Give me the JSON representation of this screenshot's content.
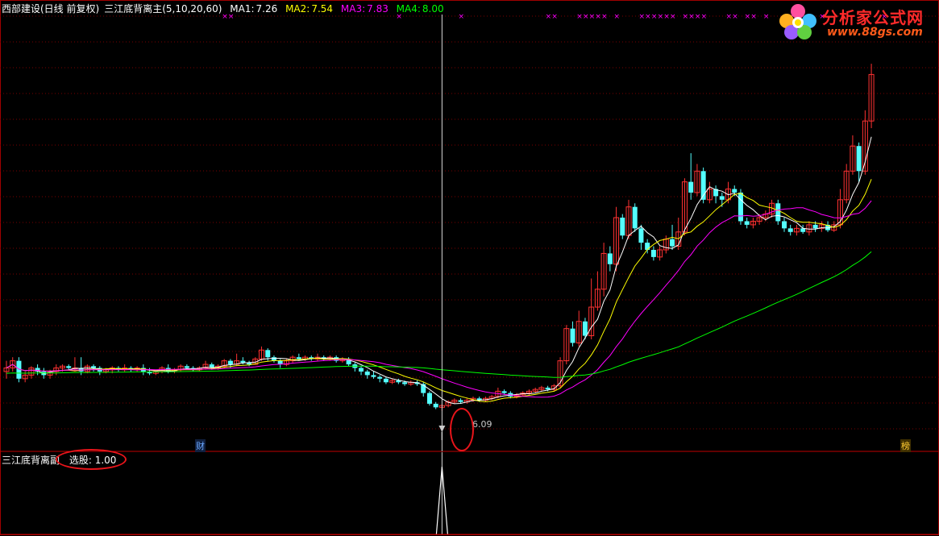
{
  "header": {
    "stock": "西部建设(日线 前复权)",
    "indicator": "三江底背离主",
    "params": "(5,10,20,60)",
    "ma1": {
      "label": "MA1:",
      "value": "7.26",
      "color": "#ffffff"
    },
    "ma2": {
      "label": "MA2:",
      "value": "7.54",
      "color": "#ffff00"
    },
    "ma3": {
      "label": "MA3:",
      "value": "7.83",
      "color": "#ff00ff"
    },
    "ma4": {
      "label": "MA4:",
      "value": "8.00",
      "color": "#00ff00"
    }
  },
  "lower": {
    "title": "三江底背离副",
    "selection_label": "选股:",
    "selection_value": "1.00"
  },
  "logo": {
    "title": "分析家公式网",
    "url": "www.88gs.com"
  },
  "annotations": {
    "low_price": "6.09",
    "fin_marker": "财",
    "rank_marker": "榜"
  },
  "colors": {
    "up": "#ff3232",
    "down": "#54ffff",
    "grid": "#7a0000",
    "ma1": "#ffffff",
    "ma2": "#ffff00",
    "ma3": "#ff00ff",
    "ma4": "#00ff00",
    "cross": "#ff00ff"
  },
  "chart_data": {
    "type": "candlestick",
    "main_cross_marks": [
      35,
      36,
      63,
      73,
      87,
      88,
      92,
      93,
      94,
      95,
      96,
      98,
      102,
      103,
      104,
      105,
      106,
      107,
      109,
      110,
      111,
      112,
      116,
      117,
      119,
      120,
      122,
      126,
      131,
      141
    ],
    "candles": [
      [
        7.2,
        7.3,
        7.5,
        7.0
      ],
      [
        7.3,
        7.5,
        7.6,
        7.2
      ],
      [
        7.5,
        7.0,
        7.6,
        6.9
      ],
      [
        7.0,
        7.1,
        7.2,
        6.9
      ],
      [
        7.1,
        7.3,
        7.35,
        7.0
      ],
      [
        7.3,
        7.2,
        7.4,
        7.1
      ],
      [
        7.2,
        7.1,
        7.3,
        7.0
      ],
      [
        7.1,
        7.2,
        7.25,
        7.0
      ],
      [
        7.2,
        7.3,
        7.4,
        7.1
      ],
      [
        7.3,
        7.35,
        7.4,
        7.2
      ],
      [
        7.35,
        7.3,
        7.4,
        7.25
      ],
      [
        7.3,
        7.3,
        7.6,
        7.2
      ],
      [
        7.3,
        7.2,
        7.6,
        7.1
      ],
      [
        7.2,
        7.35,
        7.4,
        7.15
      ],
      [
        7.35,
        7.3,
        7.4,
        7.2
      ],
      [
        7.3,
        7.2,
        7.35,
        7.1
      ],
      [
        7.2,
        7.25,
        7.3,
        7.15
      ],
      [
        7.25,
        7.3,
        7.35,
        7.15
      ],
      [
        7.3,
        7.25,
        7.35,
        7.2
      ],
      [
        7.25,
        7.3,
        7.4,
        7.2
      ],
      [
        7.3,
        7.25,
        7.35,
        7.2
      ],
      [
        7.25,
        7.3,
        7.35,
        7.2
      ],
      [
        7.3,
        7.2,
        7.4,
        7.1
      ],
      [
        7.2,
        7.15,
        7.3,
        7.1
      ],
      [
        7.15,
        7.2,
        7.25,
        7.1
      ],
      [
        7.2,
        7.3,
        7.35,
        7.15
      ],
      [
        7.3,
        7.2,
        7.4,
        7.15
      ],
      [
        7.2,
        7.25,
        7.3,
        7.15
      ],
      [
        7.25,
        7.35,
        7.4,
        7.2
      ],
      [
        7.35,
        7.3,
        7.4,
        7.25
      ],
      [
        7.3,
        7.25,
        7.35,
        7.2
      ],
      [
        7.25,
        7.3,
        7.35,
        7.2
      ],
      [
        7.3,
        7.4,
        7.5,
        7.25
      ],
      [
        7.4,
        7.3,
        7.45,
        7.25
      ],
      [
        7.3,
        7.35,
        7.4,
        7.25
      ],
      [
        7.35,
        7.5,
        7.55,
        7.3
      ],
      [
        7.5,
        7.4,
        7.55,
        7.3
      ],
      [
        7.4,
        7.5,
        7.7,
        7.35
      ],
      [
        7.5,
        7.45,
        7.6,
        7.4
      ],
      [
        7.45,
        7.4,
        7.5,
        7.35
      ],
      [
        7.4,
        7.55,
        7.6,
        7.4
      ],
      [
        7.55,
        7.8,
        7.9,
        7.5
      ],
      [
        7.8,
        7.6,
        7.85,
        7.5
      ],
      [
        7.6,
        7.5,
        7.65,
        7.45
      ],
      [
        7.5,
        7.4,
        7.55,
        7.3
      ],
      [
        7.4,
        7.5,
        7.55,
        7.35
      ],
      [
        7.5,
        7.6,
        7.65,
        7.45
      ],
      [
        7.6,
        7.55,
        7.7,
        7.5
      ],
      [
        7.55,
        7.6,
        7.65,
        7.5
      ],
      [
        7.6,
        7.55,
        7.65,
        7.5
      ],
      [
        7.55,
        7.6,
        7.7,
        7.5
      ],
      [
        7.6,
        7.55,
        7.65,
        7.5
      ],
      [
        7.55,
        7.6,
        7.65,
        7.5
      ],
      [
        7.6,
        7.5,
        7.65,
        7.45
      ],
      [
        7.5,
        7.55,
        7.6,
        7.45
      ],
      [
        7.55,
        7.4,
        7.6,
        7.35
      ],
      [
        7.4,
        7.3,
        7.45,
        7.2
      ],
      [
        7.3,
        7.2,
        7.35,
        7.1
      ],
      [
        7.2,
        7.1,
        7.25,
        7.0
      ],
      [
        7.1,
        7.05,
        7.2,
        7.0
      ],
      [
        7.05,
        7.0,
        7.1,
        6.9
      ],
      [
        7.0,
        6.9,
        7.05,
        6.85
      ],
      [
        6.9,
        6.95,
        7.0,
        6.85
      ],
      [
        6.95,
        6.9,
        7.0,
        6.85
      ],
      [
        6.9,
        6.85,
        6.95,
        6.8
      ],
      [
        6.85,
        6.9,
        6.95,
        6.8
      ],
      [
        6.9,
        6.85,
        6.95,
        6.8
      ],
      [
        6.85,
        6.6,
        6.9,
        6.5
      ],
      [
        6.6,
        6.3,
        6.65,
        6.25
      ],
      [
        6.3,
        6.2,
        6.35,
        6.15
      ],
      [
        6.2,
        6.25,
        6.3,
        6.1
      ],
      [
        6.25,
        6.35,
        6.4,
        6.2
      ],
      [
        6.35,
        6.4,
        6.45,
        6.3
      ],
      [
        6.4,
        6.35,
        6.45,
        6.3
      ],
      [
        6.35,
        6.4,
        6.45,
        6.3
      ],
      [
        6.4,
        6.45,
        6.5,
        6.35
      ],
      [
        6.45,
        6.4,
        6.5,
        6.35
      ],
      [
        6.4,
        6.45,
        6.5,
        6.35
      ],
      [
        6.45,
        6.5,
        6.55,
        6.4
      ],
      [
        6.5,
        6.65,
        6.75,
        6.45
      ],
      [
        6.65,
        6.6,
        6.7,
        6.55
      ],
      [
        6.6,
        6.5,
        6.65,
        6.45
      ],
      [
        6.5,
        6.55,
        6.6,
        6.45
      ],
      [
        6.55,
        6.6,
        6.65,
        6.5
      ],
      [
        6.6,
        6.65,
        6.7,
        6.55
      ],
      [
        6.65,
        6.7,
        6.75,
        6.6
      ],
      [
        6.7,
        6.75,
        6.8,
        6.65
      ],
      [
        6.75,
        6.7,
        6.8,
        6.65
      ],
      [
        6.7,
        6.8,
        6.85,
        6.65
      ],
      [
        6.8,
        7.5,
        7.6,
        6.75
      ],
      [
        7.5,
        8.4,
        8.5,
        7.4
      ],
      [
        8.4,
        8.0,
        8.6,
        7.9
      ],
      [
        8.0,
        8.6,
        8.9,
        7.9
      ],
      [
        8.6,
        8.2,
        8.7,
        8.1
      ],
      [
        8.2,
        9.0,
        9.8,
        8.1
      ],
      [
        9.0,
        9.5,
        10.0,
        8.9
      ],
      [
        9.5,
        10.5,
        10.8,
        9.3
      ],
      [
        10.5,
        10.2,
        10.7,
        10.0
      ],
      [
        10.2,
        11.5,
        11.8,
        10.0
      ],
      [
        11.5,
        11.0,
        11.6,
        10.9
      ],
      [
        11.0,
        11.8,
        12.0,
        10.9
      ],
      [
        11.8,
        11.2,
        11.9,
        11.1
      ],
      [
        11.2,
        10.8,
        11.3,
        10.6
      ],
      [
        10.8,
        10.6,
        10.9,
        10.5
      ],
      [
        10.6,
        10.4,
        10.7,
        10.3
      ],
      [
        10.4,
        10.6,
        10.7,
        10.3
      ],
      [
        10.6,
        10.9,
        11.0,
        10.5
      ],
      [
        10.9,
        10.7,
        11.3,
        10.6
      ],
      [
        10.7,
        11.1,
        11.5,
        10.6
      ],
      [
        11.1,
        12.5,
        12.6,
        11.0
      ],
      [
        12.5,
        12.2,
        13.3,
        12.0
      ],
      [
        12.2,
        12.8,
        13.0,
        12.1
      ],
      [
        12.8,
        12.0,
        12.9,
        11.9
      ],
      [
        12.0,
        12.3,
        12.5,
        11.9
      ],
      [
        12.3,
        12.1,
        12.4,
        11.9
      ],
      [
        12.1,
        12.0,
        12.2,
        11.8
      ],
      [
        12.0,
        12.3,
        12.5,
        11.9
      ],
      [
        12.3,
        12.2,
        12.4,
        12.1
      ],
      [
        12.2,
        11.4,
        12.3,
        11.3
      ],
      [
        11.4,
        11.3,
        11.5,
        11.2
      ],
      [
        11.3,
        11.4,
        11.5,
        11.2
      ],
      [
        11.4,
        11.5,
        11.6,
        11.3
      ],
      [
        11.5,
        11.6,
        11.7,
        11.4
      ],
      [
        11.6,
        11.9,
        12.0,
        11.5
      ],
      [
        11.9,
        11.4,
        12.0,
        11.3
      ],
      [
        11.4,
        11.2,
        11.5,
        11.1
      ],
      [
        11.2,
        11.1,
        11.3,
        11.0
      ],
      [
        11.1,
        11.2,
        11.3,
        11.0
      ],
      [
        11.2,
        11.1,
        11.3,
        11.05
      ],
      [
        11.1,
        11.3,
        11.4,
        11.0
      ],
      [
        11.3,
        11.2,
        11.4,
        11.1
      ],
      [
        11.2,
        11.3,
        11.4,
        11.1
      ],
      [
        11.3,
        11.15,
        11.4,
        11.1
      ],
      [
        11.15,
        11.3,
        11.4,
        11.1
      ],
      [
        11.3,
        12.0,
        12.3,
        11.2
      ],
      [
        12.0,
        12.8,
        13.0,
        11.9
      ],
      [
        12.8,
        13.5,
        13.8,
        12.7
      ],
      [
        13.5,
        12.8,
        13.6,
        12.5
      ],
      [
        12.8,
        14.2,
        14.5,
        12.7
      ],
      [
        14.2,
        15.5,
        15.8,
        14.0
      ]
    ],
    "ma1_last": 7.26,
    "ma2_last": 7.54,
    "ma3_last": 7.83,
    "ma4_last": 8.0,
    "signal_index": 70,
    "signal_value": 1.0
  }
}
